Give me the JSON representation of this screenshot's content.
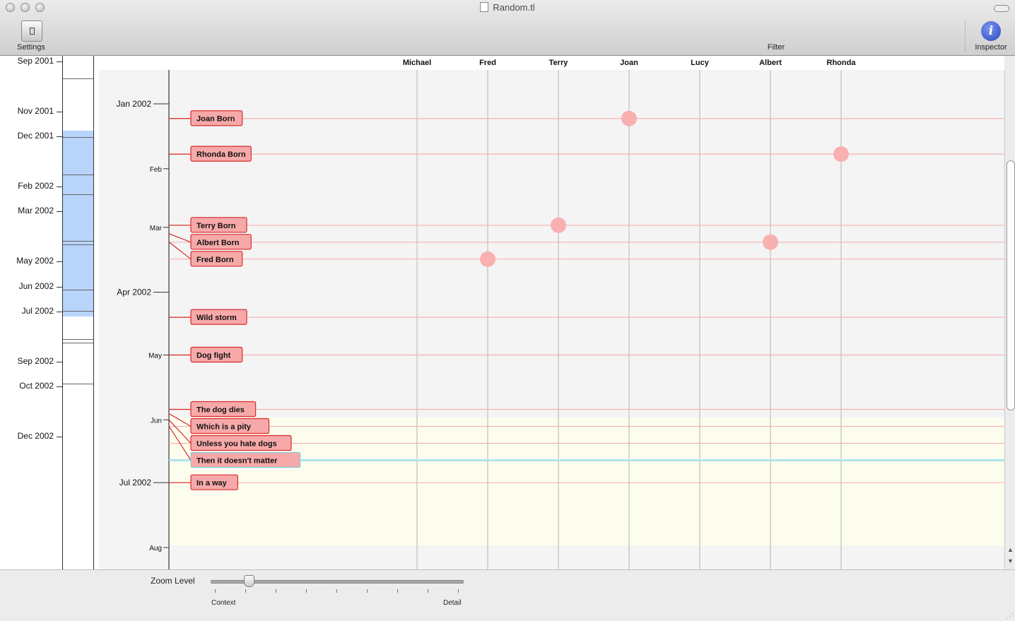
{
  "window": {
    "title": "Random.tl"
  },
  "toolbar": {
    "settings_label": "Settings",
    "filter_label": "Filter",
    "inspector_label": "Inspector",
    "inspector_glyph": "i"
  },
  "overview": {
    "labels": [
      {
        "text": "Sep 2001",
        "date": "2001-09"
      },
      {
        "text": "Nov 2001",
        "date": "2001-11"
      },
      {
        "text": "Dec 2001",
        "date": "2001-12"
      },
      {
        "text": "Feb 2002",
        "date": "2002-02"
      },
      {
        "text": "Mar 2002",
        "date": "2002-03"
      },
      {
        "text": "May 2002",
        "date": "2002-05"
      },
      {
        "text": "Jun 2002",
        "date": "2002-06"
      },
      {
        "text": "Jul 2002",
        "date": "2002-07"
      },
      {
        "text": "Sep 2002",
        "date": "2002-09"
      },
      {
        "text": "Oct 2002",
        "date": "2002-10"
      },
      {
        "text": "Dec 2002",
        "date": "2002-12"
      }
    ],
    "visible_range": [
      "2001-12",
      "2002-08"
    ]
  },
  "timeline": {
    "axis_labels": [
      {
        "text": "Jan 2002",
        "date": "2002-01-01",
        "major": true
      },
      {
        "text": "Feb",
        "date": "2002-02-01",
        "major": false
      },
      {
        "text": "Mar",
        "date": "2002-03-01",
        "major": false
      },
      {
        "text": "Apr 2002",
        "date": "2002-04-01",
        "major": true
      },
      {
        "text": "May",
        "date": "2002-05-01",
        "major": false
      },
      {
        "text": "Jun",
        "date": "2002-06-01",
        "major": false
      },
      {
        "text": "Jul 2002",
        "date": "2002-07-01",
        "major": true
      },
      {
        "text": "Aug",
        "date": "2002-08-01",
        "major": false
      }
    ],
    "people": [
      "Michael",
      "Fred",
      "Terry",
      "Joan",
      "Lucy",
      "Albert",
      "Rhonda"
    ],
    "events": [
      {
        "label": "Joan Born",
        "date": "2002-01-08",
        "person": "Joan",
        "selected": false
      },
      {
        "label": "Rhonda Born",
        "date": "2002-01-25",
        "person": "Rhonda",
        "selected": false
      },
      {
        "label": "Terry Born",
        "date": "2002-02-28",
        "person": "Terry",
        "selected": false
      },
      {
        "label": "Albert Born",
        "date": "2002-03-04",
        "person": "Albert",
        "selected": false
      },
      {
        "label": "Fred Born",
        "date": "2002-03-08",
        "person": "Fred",
        "selected": false
      },
      {
        "label": "Wild storm",
        "date": "2002-04-13",
        "person": null,
        "selected": false
      },
      {
        "label": "Dog fight",
        "date": "2002-05-01",
        "person": null,
        "selected": false
      },
      {
        "label": "The dog dies",
        "date": "2002-05-27",
        "person": null,
        "selected": false
      },
      {
        "label": "Which is a pity",
        "date": "2002-05-29",
        "person": null,
        "selected": false
      },
      {
        "label": "Unless you hate dogs",
        "date": "2002-06-01",
        "person": null,
        "selected": false
      },
      {
        "label": "Then it doesn't matter",
        "date": "2002-06-04",
        "person": null,
        "selected": true
      },
      {
        "label": "In a way",
        "date": "2002-07-01",
        "person": null,
        "selected": false
      }
    ],
    "highlight_period": [
      "2002-05-31",
      "2002-07-31"
    ]
  },
  "zoom": {
    "label": "Zoom Level",
    "left_label": "Context",
    "right_label": "Detail",
    "level": 0.14,
    "steps": 9
  },
  "colors": {
    "event_fill": "#f7a9a9",
    "event_border": "#d92b2b",
    "event_line": "#f4b4b4",
    "dot": "#f9b0b0",
    "person_line": "#c9c9c9",
    "highlight": "#fdfdee",
    "selected": "#aee5ec",
    "overview_range": "#b8d4fa"
  }
}
